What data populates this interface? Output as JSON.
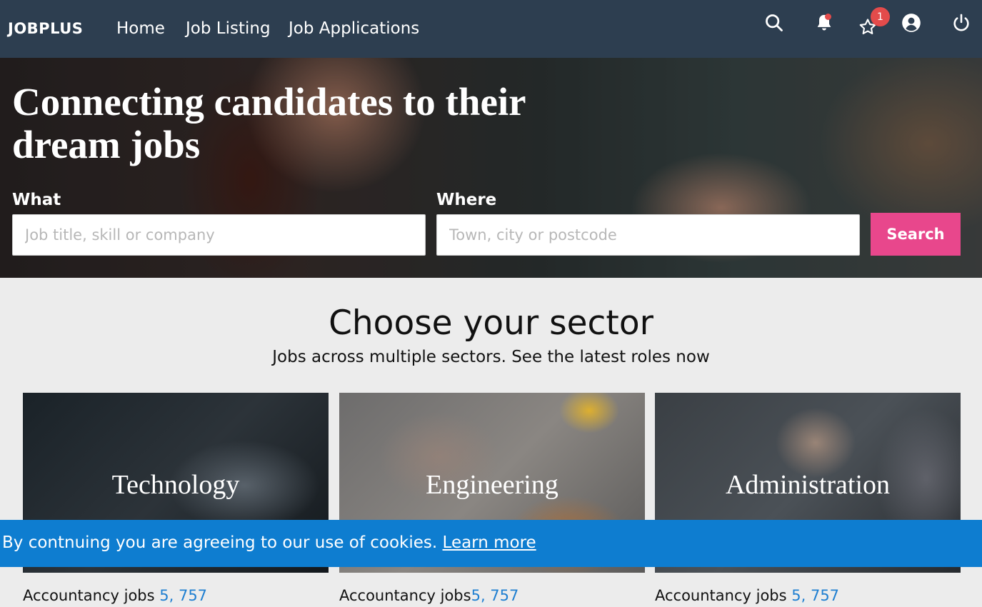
{
  "nav": {
    "brand": "JOBPLUS",
    "links": [
      "Home",
      "Job Listing",
      "Job Applications"
    ],
    "favorites_badge": "1"
  },
  "hero": {
    "title": "Connecting candidates to their dream jobs",
    "what_label": "What",
    "what_placeholder": "Job title, skill or company",
    "where_label": "Where",
    "where_placeholder": "Town, city or postcode",
    "search_label": "Search"
  },
  "sectors": {
    "title": "Choose your sector",
    "subtitle": "Jobs across multiple sectors. See the latest roles now",
    "cards": [
      {
        "name": "Technology",
        "count_label": "Accountancy jobs ",
        "count": "5, 757"
      },
      {
        "name": "Engineering",
        "count_label": "Accountancy jobs",
        "count": "5, 757"
      },
      {
        "name": "Administration",
        "count_label": "Accountancy jobs ",
        "count": "5, 757"
      }
    ]
  },
  "cookie": {
    "text": "By contnuing you are agreeing to our use of cookies. ",
    "link": "Learn more"
  }
}
